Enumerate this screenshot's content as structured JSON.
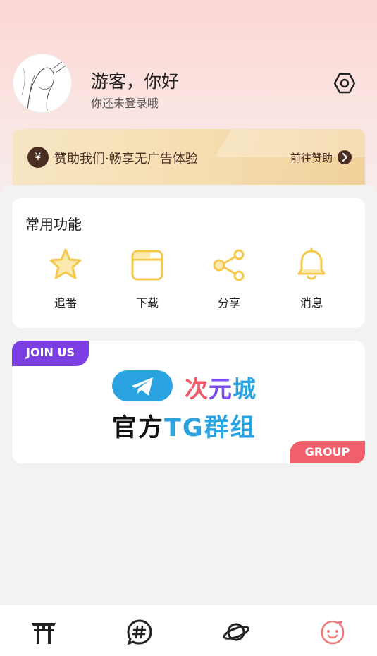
{
  "profile": {
    "greeting": "游客，你好",
    "subtitle": "你还未登录哦"
  },
  "sponsor": {
    "icon_text": "¥",
    "text": "赞助我们·畅享无广告体验",
    "link_label": "前往赞助"
  },
  "features": {
    "title": "常用功能",
    "items": [
      {
        "label": "追番",
        "icon": "star-icon"
      },
      {
        "label": "下载",
        "icon": "folder-icon"
      },
      {
        "label": "分享",
        "icon": "share-icon"
      },
      {
        "label": "消息",
        "icon": "bell-icon"
      }
    ]
  },
  "banner": {
    "join_tag": "JOIN US",
    "group_tag": "GROUP",
    "brand_chars": [
      "次",
      "元",
      "城"
    ],
    "official_prefix": "官方",
    "official_highlight": "TG群组"
  },
  "tabbar": {
    "items": [
      "torii-gate-icon",
      "hashtag-chat-icon",
      "planet-icon",
      "smiley-face-icon"
    ],
    "active_index": 3
  },
  "colors": {
    "accent_yellow": "#f5c84a",
    "sponsor_brown": "#4a2e22",
    "purple": "#7b3fe4",
    "red": "#f0606a",
    "telegram_blue": "#2aa3e0",
    "active_tab": "#f07a7a"
  }
}
